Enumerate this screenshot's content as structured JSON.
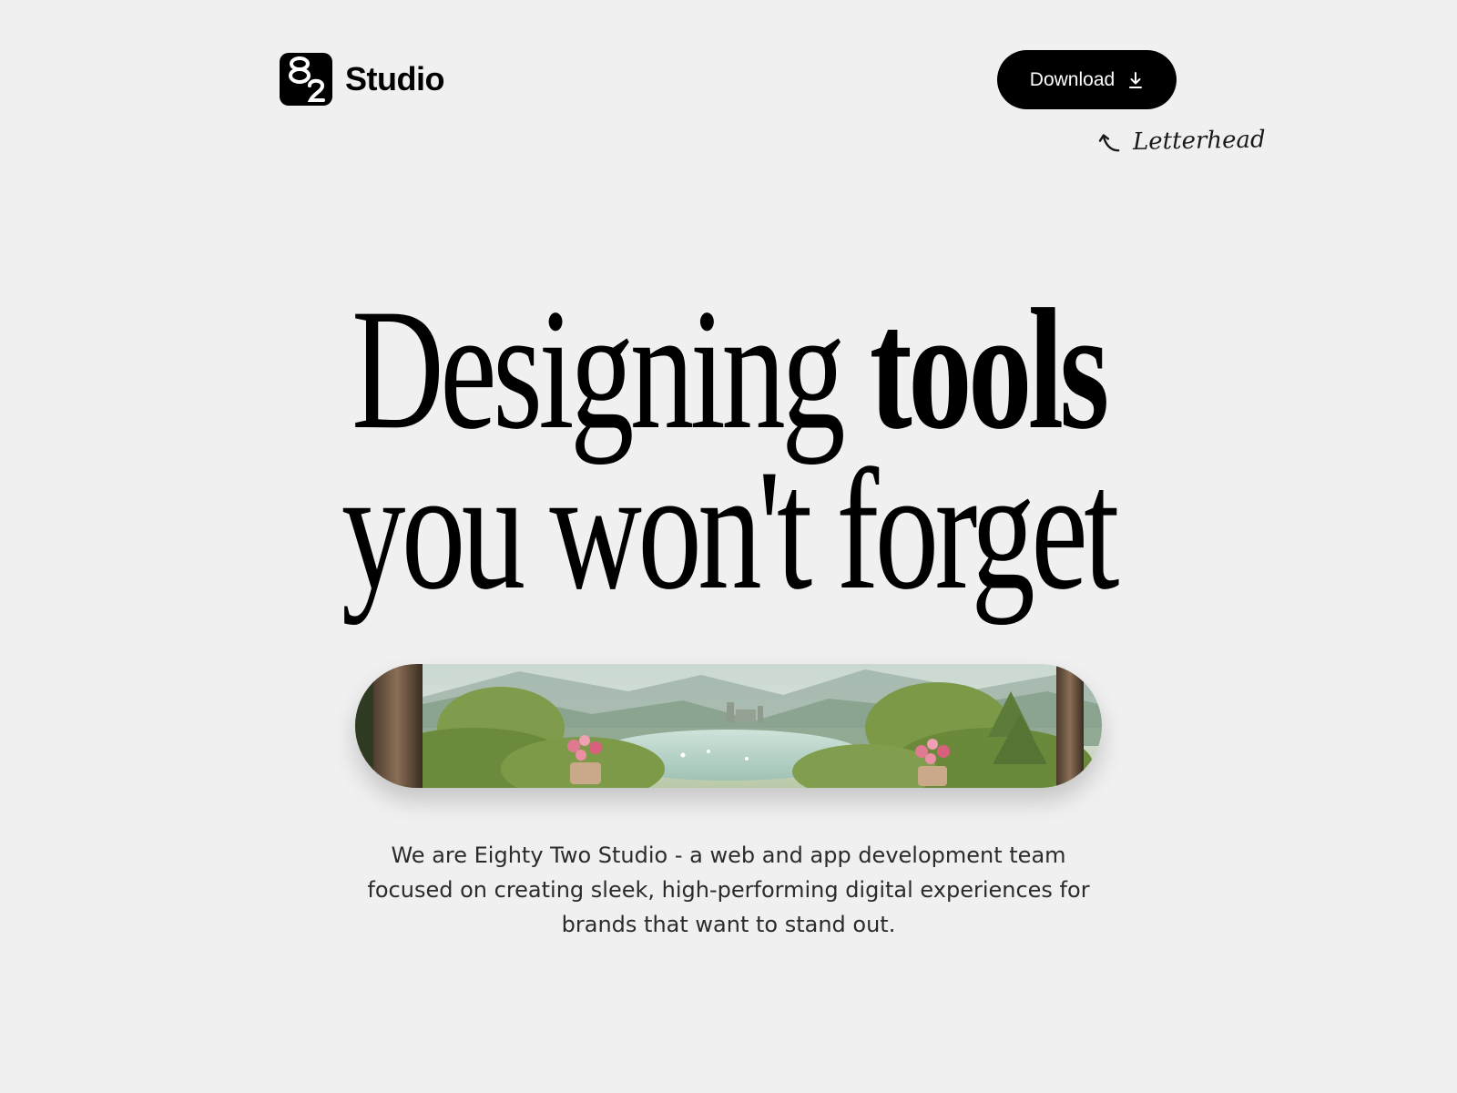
{
  "header": {
    "brand_name": "Studio",
    "logo_icon": "eighty-two-logo-icon",
    "download_label": "Download",
    "download_icon": "download-icon"
  },
  "annotation": {
    "label": "Letterhead",
    "arrow_icon": "curved-arrow-up-left-icon"
  },
  "hero": {
    "headline_part1": "Designing ",
    "headline_bold": "tools",
    "headline_line2": "you won't forget",
    "image_alt_subject": "lake landscape with flowers"
  },
  "body": {
    "tagline": "We are Eighty Two Studio - a web and app development team focused on creating sleek, high-performing digital experiences for brands that want to stand out."
  },
  "colors": {
    "background": "#f0f0f0",
    "button": "#000000",
    "button_text": "#ffffff",
    "text": "#000000",
    "body_text": "#2b2b2b"
  }
}
